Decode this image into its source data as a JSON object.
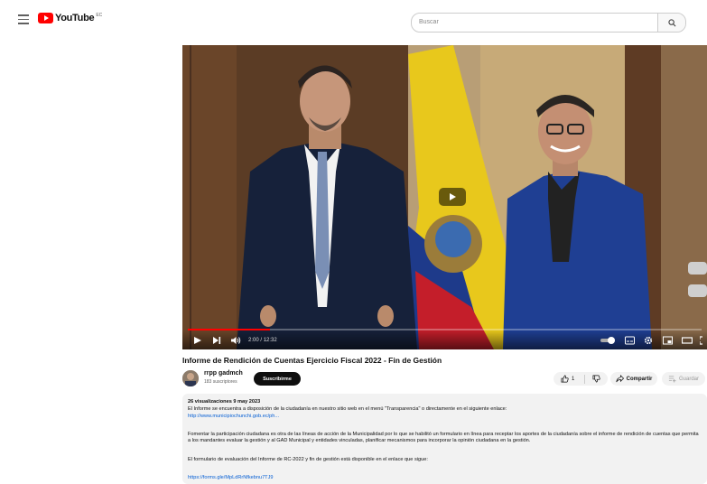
{
  "header": {
    "logo_text": "YouTube",
    "country_code": "EC",
    "search_placeholder": "Buscar"
  },
  "player": {
    "time_current": "2:00",
    "time_separator": " / ",
    "time_total": "12:32",
    "progress_fraction": 0.16
  },
  "video": {
    "title": "Informe de Rendición de Cuentas Ejercicio Fiscal 2022 - Fin de Gestión",
    "channel_name": "rrpp gadmch",
    "subscribers": "183 suscriptores",
    "subscribe_label": "Suscribirme",
    "like_count": "1",
    "share_label": "Compartir",
    "save_label": "Guardar"
  },
  "description": {
    "meta": "26 visualizaciones  9 may 2023",
    "line1": "El Informe se encuentra a disposición de la ciudadanía en nuestro sitio web en el menú \"Transparencia\" o directamente en el siguiente enlace:",
    "link1": "http://www.municipiochunchi.gob.ec/ph...",
    "para2": "Fomentar la participación ciudadana es otra de las líneas de acción de la Municipalidad por lo que se habilitó un formulario en línea para receptar los aportes de la ciudadanía sobre el informe de rendición de cuentas que permita a los mandantes evaluar la gestión y al GAD Municipal y entidades vinculadas, planificar mecanismos para incorporar la opinión ciudadana en la gestión.",
    "para3": "El formulario de evaluación del Informe de RC-2022 y fin de gestión está disponible en el enlace que sigue:",
    "link2": "https://forms.gle/MpLdRrNfkebnu7TJ9"
  },
  "colors": {
    "brand": "#ff0000",
    "link": "#065fd4",
    "chip_bg": "#f2f2f2"
  }
}
